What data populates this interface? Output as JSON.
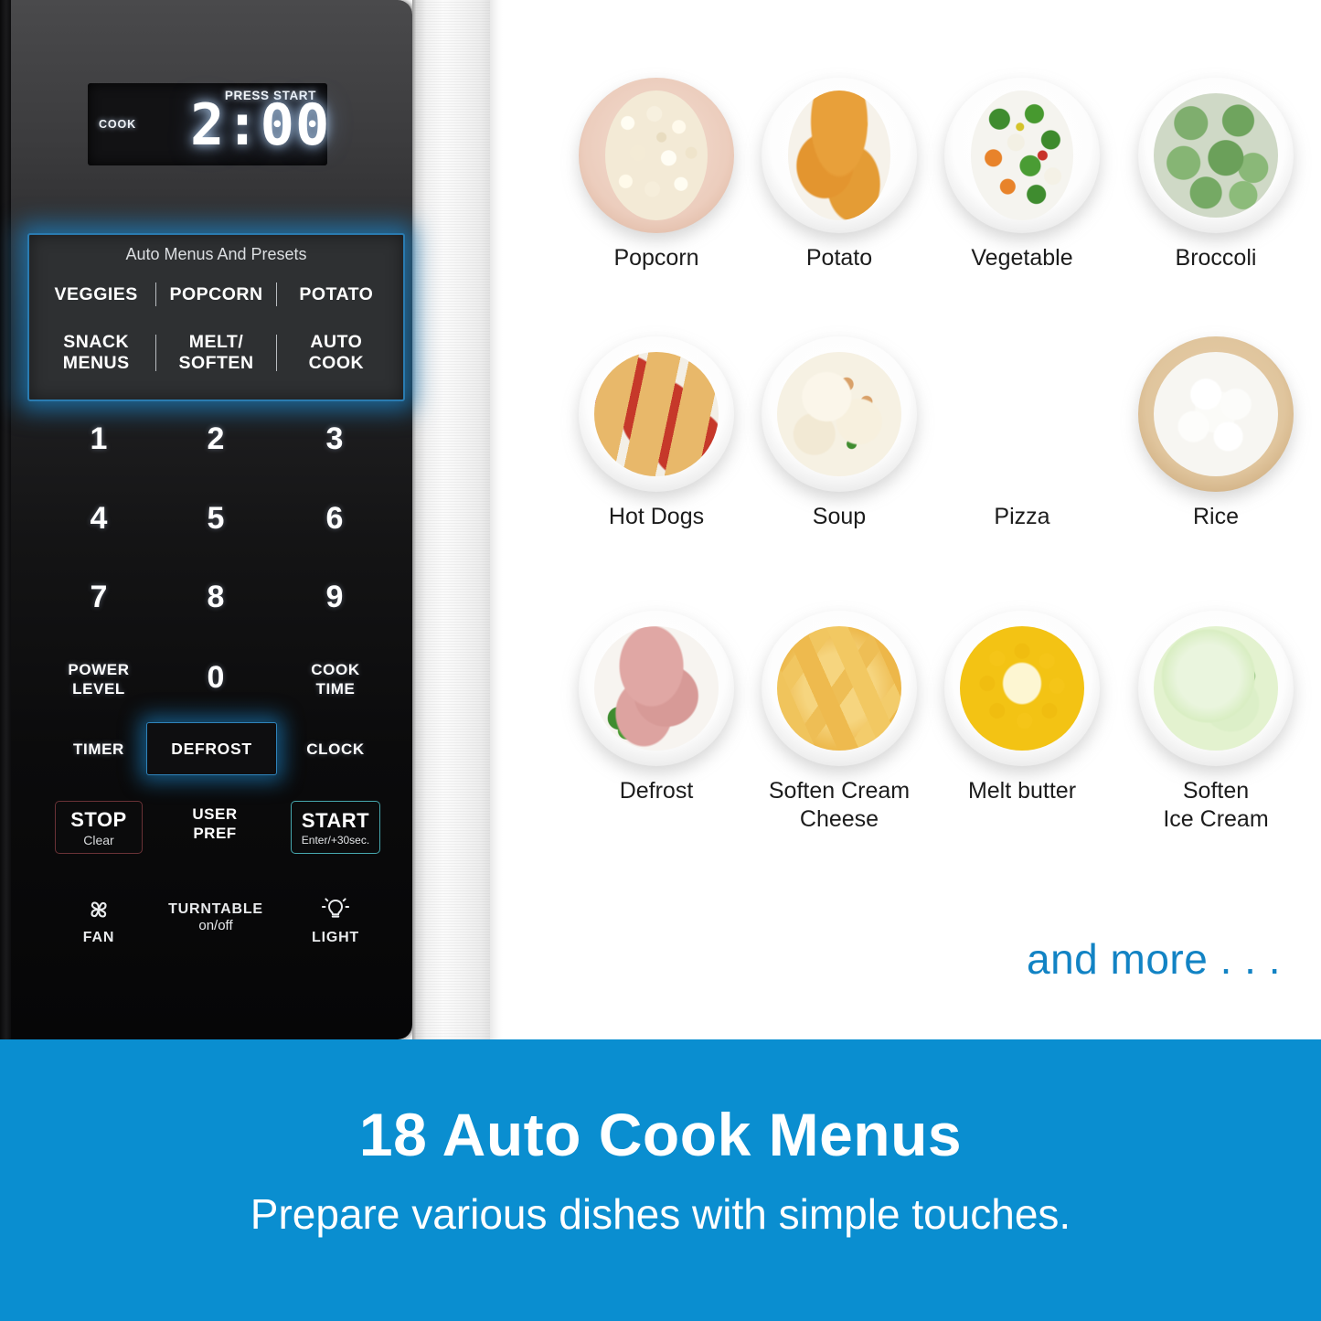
{
  "microwave": {
    "display": {
      "press_start": "PRESS START",
      "cook_label": "COOK",
      "time": "2:00"
    },
    "auto_panel": {
      "title": "Auto Menus And Presets",
      "row1": [
        "VEGGIES",
        "POPCORN",
        "POTATO"
      ],
      "row2": [
        "SNACK\nMENUS",
        "MELT/\nSOFTEN",
        "AUTO\nCOOK"
      ],
      "row2_lines": [
        [
          "SNACK",
          "MENUS"
        ],
        [
          "MELT/",
          "SOFTEN"
        ],
        [
          "AUTO",
          "COOK"
        ]
      ]
    },
    "keypad": [
      "1",
      "2",
      "3",
      "4",
      "5",
      "6",
      "7",
      "8",
      "9",
      "0"
    ],
    "functions": {
      "power_level_l1": "POWER",
      "power_level_l2": "LEVEL",
      "cook_time_l1": "COOK",
      "cook_time_l2": "TIME",
      "timer": "TIMER",
      "defrost": "DEFROST",
      "clock": "CLOCK"
    },
    "action_buttons": {
      "stop_main": "STOP",
      "stop_sub": "Clear",
      "user_pref_l1": "USER",
      "user_pref_l2": "PREF",
      "start_main": "START",
      "start_sub": "Enter/+30sec."
    },
    "icon_buttons": {
      "fan": "FAN",
      "turntable_l1": "TURNTABLE",
      "turntable_l2": "on/off",
      "light": "LIGHT"
    }
  },
  "food_grid": {
    "items": [
      {
        "label": "Popcorn",
        "label_l2": ""
      },
      {
        "label": "Potato",
        "label_l2": ""
      },
      {
        "label": "Vegetable",
        "label_l2": ""
      },
      {
        "label": "Broccoli",
        "label_l2": ""
      },
      {
        "label": "Hot Dogs",
        "label_l2": ""
      },
      {
        "label": "Soup",
        "label_l2": ""
      },
      {
        "label": "Pizza",
        "label_l2": ""
      },
      {
        "label": "Rice",
        "label_l2": ""
      },
      {
        "label": "Defrost",
        "label_l2": ""
      },
      {
        "label": "Soften Cream",
        "label_l2": "Cheese"
      },
      {
        "label": "Melt butter",
        "label_l2": ""
      },
      {
        "label": "Soften",
        "label_l2": "Ice Cream"
      }
    ],
    "and_more": "and more . . ."
  },
  "banner": {
    "title": "18 Auto Cook Menus",
    "subtitle": "Prepare various dishes with simple touches."
  },
  "colors": {
    "banner_blue": "#0a8ed0",
    "accent_blue": "#1283c4",
    "glow_blue": "#1c84c8",
    "stop_red": "#6a3236",
    "start_teal": "#46a7ae"
  }
}
